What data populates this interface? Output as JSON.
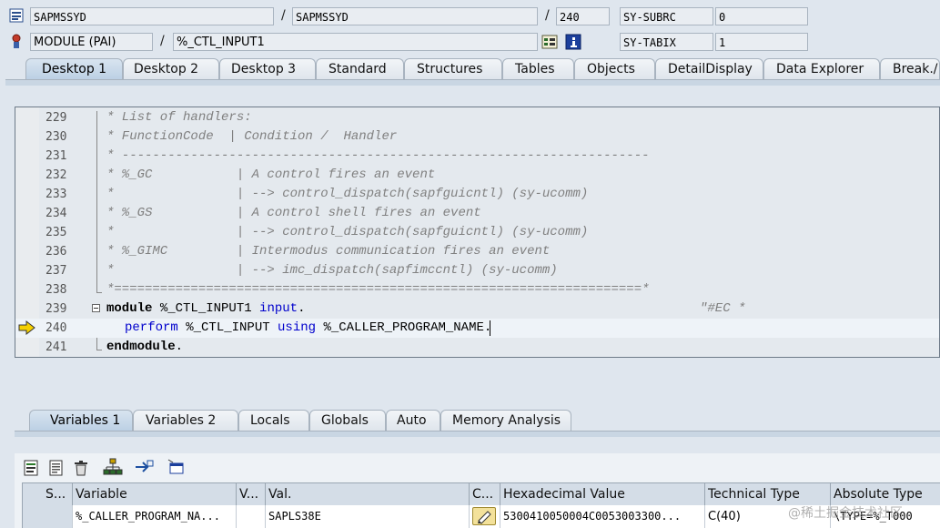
{
  "header": {
    "program_1": "SAPMSSYD",
    "program_2": "SAPMSSYD",
    "line_no": "240",
    "subrc_label": "SY-SUBRC",
    "subrc_value": "0",
    "event_type": "MODULE (PAI)",
    "event_name": "%_CTL_INPUT1",
    "tabix_label": "SY-TABIX",
    "tabix_value": "1",
    "slash": "/"
  },
  "main_tabs": [
    "Desktop 1",
    "Desktop 2",
    "Desktop 3",
    "Standard",
    "Structures",
    "Tables",
    "Objects",
    "DetailDisplay",
    "Data Explorer",
    "Break./"
  ],
  "code_lines": [
    {
      "n": "229",
      "text": "* List of handlers:"
    },
    {
      "n": "230",
      "text": "* FunctionCode  | Condition /  Handler"
    },
    {
      "n": "231",
      "text": "* ---------------------------------------------------------------------"
    },
    {
      "n": "232",
      "text": "* %_GC           | A control fires an event"
    },
    {
      "n": "233",
      "text": "*                | --> control_dispatch(sapfguicntl) (sy-ucomm)"
    },
    {
      "n": "234",
      "text": "* %_GS           | A control shell fires an event"
    },
    {
      "n": "235",
      "text": "*                | --> control_dispatch(sapfguicntl) (sy-ucomm)"
    },
    {
      "n": "236",
      "text": "* %_GIMC         | Intermodus communication fires an event"
    },
    {
      "n": "237",
      "text": "*                | --> imc_dispatch(sapfimccntl) (sy-ucomm)"
    },
    {
      "n": "238",
      "text": "*=====================================================================*"
    },
    {
      "n": "239",
      "kw1": "module",
      "plain1": " %_CTL_INPUT1 ",
      "kw2": "input",
      "plain2": ".",
      "cmt": "\"#EC *"
    },
    {
      "n": "240",
      "kw1": "perform",
      "plain1": " %_CTL_INPUT ",
      "kw2": "using",
      "plain2": " %_CALLER_PROGRAM_NAME."
    },
    {
      "n": "241",
      "kw1": "endmodule",
      "plain1": "."
    }
  ],
  "var_tabs": [
    "Variables 1",
    "Variables 2",
    "Locals",
    "Globals",
    "Auto",
    "Memory Analysis"
  ],
  "grid": {
    "headers": [
      "S...",
      "Variable",
      "V...",
      "Val.",
      "C...",
      "Hexadecimal Value",
      "Technical Type",
      "Absolute Type"
    ],
    "row": {
      "variable": "%_CALLER_PROGRAM_NA...",
      "value": "SAPLS38E",
      "hex": "5300410050004C0053003300...",
      "tech_type": "C(40)",
      "abs_type": "\\TYPE=%_T000"
    }
  },
  "watermark": "@稀土掘金技术社区",
  "colors": {
    "keyword": "#0000cc",
    "comment": "#808080",
    "active_tab": "#bcd0e4",
    "highlight_line": "#eef3f8"
  }
}
